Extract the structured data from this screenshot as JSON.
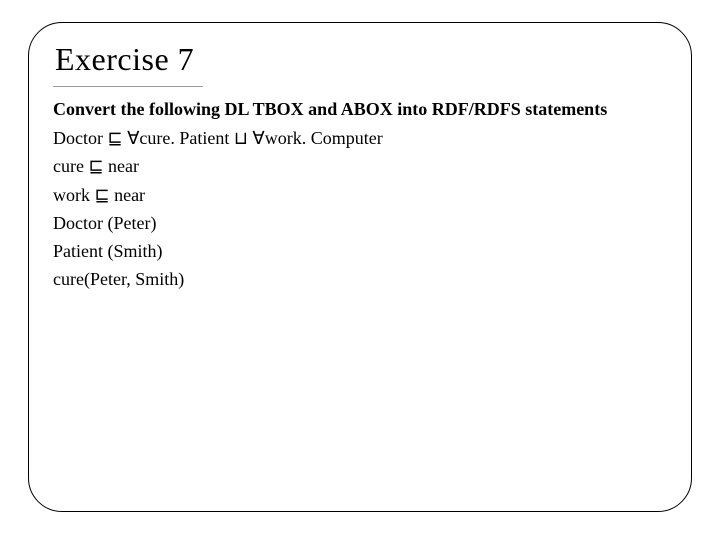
{
  "title": "Exercise 7",
  "prompt": "Convert the following DL TBOX and ABOX into RDF/RDFS statements",
  "lines": {
    "l1": "Doctor ⊑ ∀cure. Patient ⊔ ∀work. Computer",
    "l2": "cure ⊑ near",
    "l3": "work ⊑ near",
    "l4": "Doctor (Peter)",
    "l5": "Patient (Smith)",
    "l6": "cure(Peter, Smith)"
  }
}
